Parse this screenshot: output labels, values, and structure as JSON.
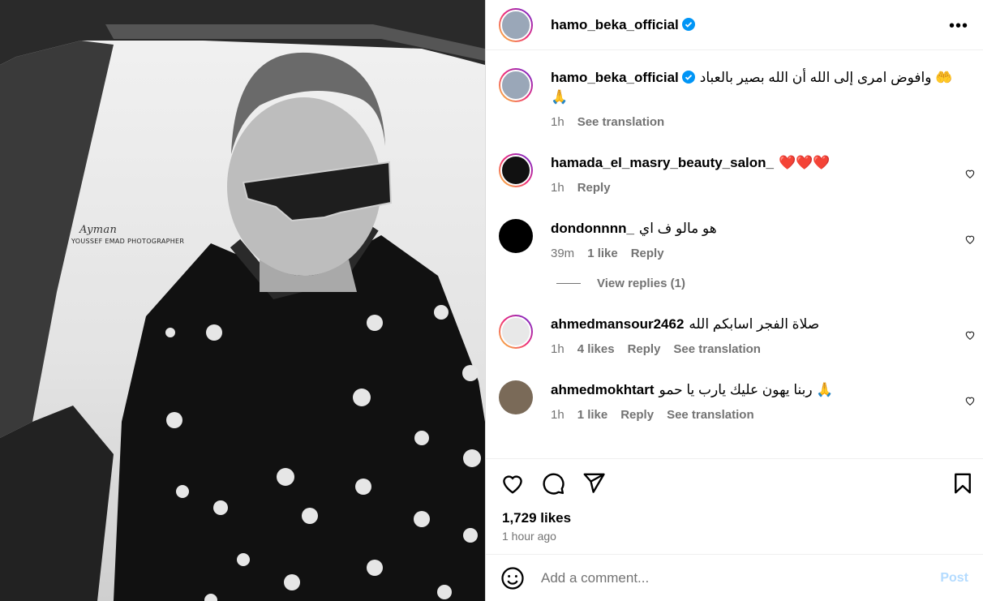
{
  "post": {
    "author": "hamo_beka_official",
    "caption": "وافوض امرى إلى الله أن الله بصير بالعباد 🤲 🙏",
    "caption_time": "1h",
    "see_translation": "See translation",
    "likes": "1,729 likes",
    "time_ago": "1 hour ago",
    "photo_watermark_name": "YOUSSEF EMAD PHOTOGRAPHER",
    "photo_watermark_signature": "Ayman"
  },
  "comments": [
    {
      "user": "hamada_el_masry_beauty_salon_",
      "text": "❤️❤️❤️",
      "time": "1h",
      "likes": "",
      "reply": "Reply",
      "translate": ""
    },
    {
      "user": "dondonnnn_",
      "text": "هو مالو ف اي",
      "time": "39m",
      "likes": "1 like",
      "reply": "Reply",
      "translate": ""
    },
    {
      "user": "ahmedmansour2462",
      "text": "صلاة الفجر اسابكم الله",
      "time": "1h",
      "likes": "4 likes",
      "reply": "Reply",
      "translate": "See translation"
    },
    {
      "user": "ahmedmokhtart",
      "text": "ربنا يهون عليك يارب يا حمو 🙏",
      "time": "1h",
      "likes": "1 like",
      "reply": "Reply",
      "translate": "See translation"
    }
  ],
  "view_replies": "View replies (1)",
  "add_comment": {
    "placeholder": "Add a comment...",
    "post_label": "Post"
  },
  "icons": {
    "more": "more-options-icon",
    "like": "heart-icon",
    "comment": "comment-icon",
    "share": "share-icon",
    "save": "bookmark-icon",
    "emoji": "emoji-icon",
    "verified": "verified-badge-icon"
  },
  "colors": {
    "verified": "#0095f6",
    "post_disabled": "#b3dbff",
    "meta": "#737373"
  }
}
